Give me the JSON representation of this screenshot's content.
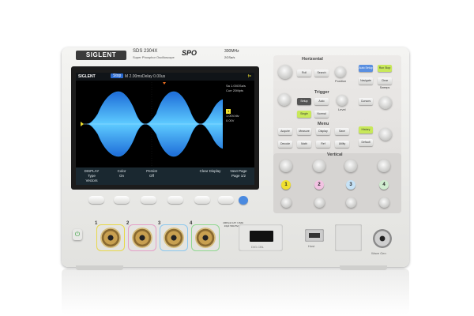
{
  "header": {
    "brand": "SIGLENT",
    "model": "SDS 2304X",
    "series": "Super Phosphor Oscilloscope",
    "tech": "SPO",
    "spec_bandwidth": "300MHz",
    "spec_rate": "2GSa/s"
  },
  "screen": {
    "logo": "SIGLENT",
    "mode": "Stop",
    "timebase": "M 2.00ms",
    "delay": "Delay 0.00us",
    "trigger_status": "f=",
    "right_info": {
      "sa_line": "Sa 1.00GSa/s",
      "curr_line": "Curr 20Mpts",
      "ch1_badge": "1",
      "ch1_scale": "1.00V/div",
      "ch1_offset": "0.00V"
    },
    "softmenu": [
      {
        "title": "DISPLAY",
        "label": "Type",
        "value": "Vectors"
      },
      {
        "title": "",
        "label": "Color",
        "value": "On"
      },
      {
        "title": "",
        "label": "Persist",
        "value": "Off"
      },
      {
        "title": "",
        "label": "",
        "value": ""
      },
      {
        "title": "",
        "label": "Clear Display",
        "value": ""
      },
      {
        "title": "",
        "label": "Next Page",
        "value": "Page 1/2"
      }
    ]
  },
  "panel": {
    "horizontal_title": "Horizontal",
    "trigger_title": "Trigger",
    "menu_title": "Menu",
    "vertical_title": "Vertical",
    "position_label": "Position",
    "level_label": "Level",
    "buttons": {
      "roll": "Roll",
      "search": "Search",
      "navigate": "Navigate",
      "auto_setup": "Auto Setup",
      "run_stop": "Run Stop",
      "single": "Single",
      "clear_sweeps": "Clear Sweeps",
      "setup": "Setup",
      "auto": "Auto",
      "normal": "Normal",
      "cursors": "Cursors",
      "acquire": "Acquire",
      "save": "Save",
      "measure": "Measure",
      "display": "Display",
      "utility": "Utility",
      "math": "Math",
      "ref": "Ref",
      "decode": "Decode",
      "history": "History",
      "default": "Default"
    },
    "channels": [
      "1",
      "2",
      "3",
      "4"
    ]
  },
  "front": {
    "channel_labels": [
      "1",
      "2",
      "3",
      "4"
    ],
    "warning": "400Vpk CAT I 1MΩ 16pF 50Ω 5Vrms",
    "slot_label": "DIG.CBL",
    "usb_label": "Host",
    "waveout_label": "Wave Gen"
  },
  "colors": {
    "ch1": "#f0e030",
    "ch2": "#e070c0",
    "ch3": "#40a8e8",
    "ch4": "#58c858",
    "trace": "#2f9cff"
  }
}
